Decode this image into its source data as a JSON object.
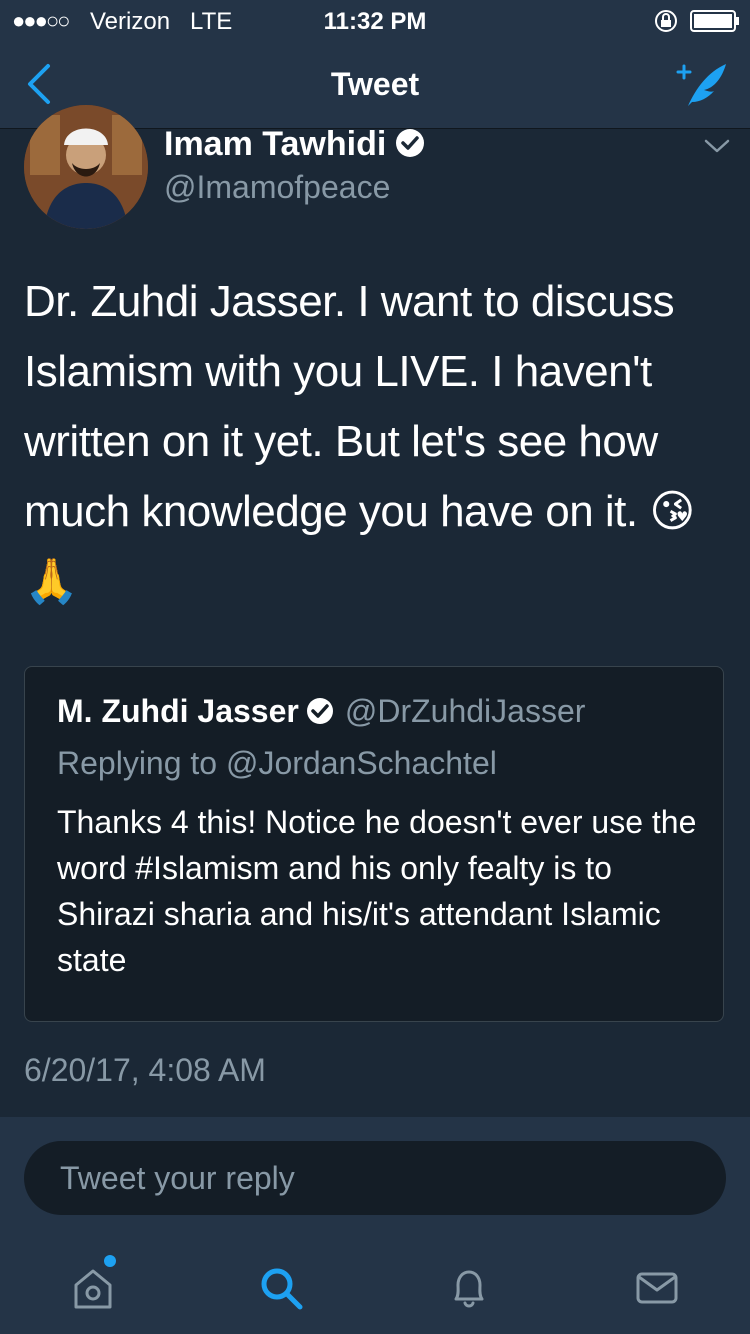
{
  "status_bar": {
    "signal": "●●●○○",
    "carrier": "Verizon",
    "network": "LTE",
    "time": "11:32 PM"
  },
  "nav": {
    "title": "Tweet",
    "back_icon": "chevron-left-icon",
    "compose_icon": "compose-tweet-icon"
  },
  "tweet": {
    "author_name": "Imam Tawhidi",
    "author_handle": "@Imamofpeace",
    "text": "Dr. Zuhdi Jasser. I want to discuss Islamism with you LIVE. I haven't written on it yet. But let's see how much knowledge you have on it. 😘🙏",
    "timestamp": "6/20/17, 4:08 AM"
  },
  "quoted_tweet": {
    "author_name": "M. Zuhdi Jasser",
    "author_handle": "@DrZuhdiJasser",
    "replying_to": "Replying to @JordanSchachtel",
    "text": "Thanks 4 this! Notice he doesn't ever use the word #Islamism and his only fealty is to Shirazi sharia and his/it's attendant Islamic state"
  },
  "reply": {
    "placeholder": "Tweet your reply"
  },
  "tabs": [
    {
      "icon": "home-icon",
      "active": false,
      "has_dot": true
    },
    {
      "icon": "search-icon",
      "active": true
    },
    {
      "icon": "bell-icon",
      "active": false
    },
    {
      "icon": "mail-icon",
      "active": false
    }
  ],
  "colors": {
    "accent": "#1da1f2",
    "background": "#141d26",
    "bar": "#243447",
    "secondary_text": "#8899a6"
  }
}
